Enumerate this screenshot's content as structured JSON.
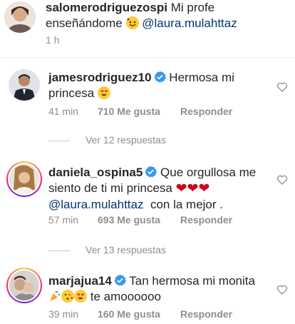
{
  "comments": [
    {
      "username": "salomerodriguezospi",
      "text_before": "Mi profe enseñándome",
      "mention": "@laura.mulahttaz",
      "time": "1 h"
    },
    {
      "username": "jamesrodriguez10",
      "text": "Hermosa mi princesa",
      "time": "41 min",
      "likes": "710 Me gusta",
      "reply": "Responder",
      "view_replies": "Ver 12 respuestas"
    },
    {
      "username": "daniela_ospina5",
      "text": "Que orgullosa me siento de ti mi princesa",
      "mention": "@laura.mulahttaz",
      "text_after": "con la mejor .",
      "time": "57 min",
      "likes": "693 Me gusta",
      "reply": "Responder",
      "view_replies": "Ver 13 respuestas"
    },
    {
      "username": "marjajua14",
      "text_before": "Tan hermosa mi monita",
      "text_after": "te amoooooo",
      "time": "39 min",
      "likes": "160 Me gusta",
      "reply": "Responder"
    }
  ],
  "colors": {
    "verified": "#3897f0",
    "mention": "#00376b",
    "meta": "#8e8e8e"
  }
}
